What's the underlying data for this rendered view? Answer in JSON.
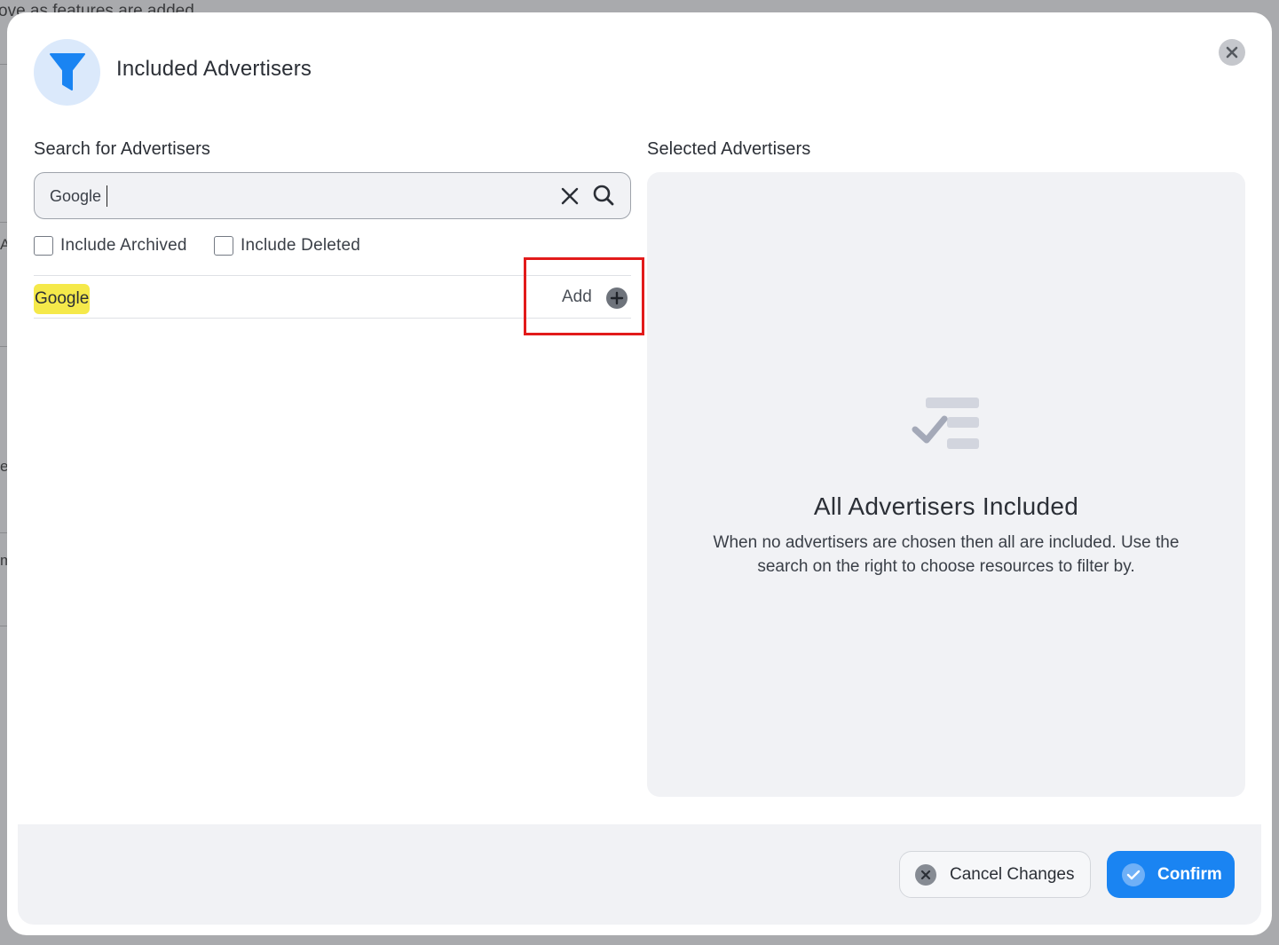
{
  "background": {
    "top_text": "ove as features are added",
    "side_letters": [
      "A",
      "e",
      "m"
    ]
  },
  "modal": {
    "title": "Included Advertisers",
    "header_icon": "filter-icon",
    "close_icon": "close-icon"
  },
  "search": {
    "label": "Search for Advertisers",
    "value": "Google",
    "placeholder": "",
    "clear_icon": "clear-icon",
    "search_icon": "search-icon",
    "options": [
      {
        "label": "Include Archived",
        "checked": false
      },
      {
        "label": "Include Deleted",
        "checked": false
      }
    ],
    "results": [
      {
        "name": "Google",
        "action_label": "Add",
        "action_icon": "plus-circle-icon"
      }
    ]
  },
  "selected": {
    "label": "Selected Advertisers",
    "empty_icon": "checklist-icon",
    "empty_title": "All Advertisers Included",
    "empty_text": "When no advertisers are chosen then all are included. Use the search on the right to choose resources to filter by."
  },
  "footer": {
    "cancel_label": "Cancel Changes",
    "cancel_icon": "x-circle-icon",
    "confirm_label": "Confirm",
    "confirm_icon": "check-circle-icon"
  },
  "colors": {
    "accent": "#1a84f2",
    "highlight": "#f5e94a",
    "annotation": "#e21b1b",
    "panel": "#f1f2f5"
  }
}
